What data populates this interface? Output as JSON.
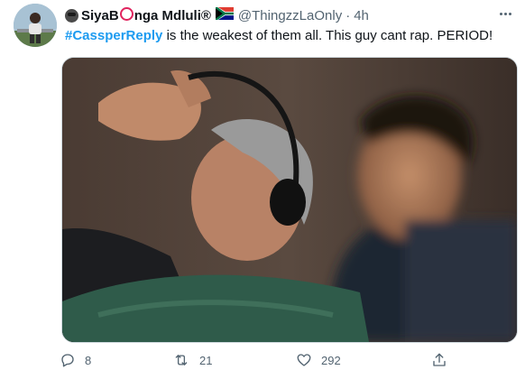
{
  "tweet": {
    "author": {
      "display_name_part1": "SiyaB",
      "display_name_part2": "nga Mdluli®",
      "name_prefix_emoji": "gorilla-emoji",
      "name_ring_symbol": "red-circle",
      "flag_emoji": "south-africa-flag",
      "handle": "@ThingzzLaOnly"
    },
    "separator": "·",
    "time": "4h",
    "text": {
      "hashtag": "#CassperReply",
      "body": " is the weakest of them all. This guy cant rap. PERIOD!"
    },
    "actions": {
      "reply_count": "8",
      "retweet_count": "21",
      "like_count": "292"
    }
  },
  "colors": {
    "link": "#1d9bf0",
    "secondary_text": "#536471",
    "primary_text": "#0f1419",
    "border": "#cfd9de"
  }
}
